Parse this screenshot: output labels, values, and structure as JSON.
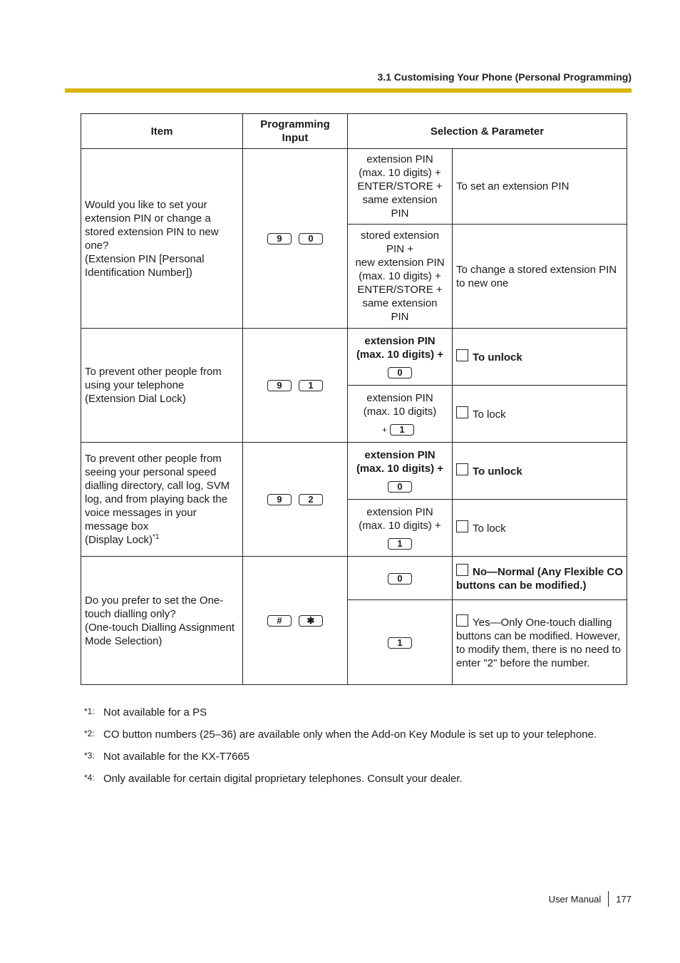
{
  "header": {
    "section_title": "3.1 Customising Your Phone (Personal Programming)",
    "rule_color": "#d9b50a"
  },
  "table": {
    "columns": [
      "Item",
      "Programming Input",
      "Selection & Parameter"
    ],
    "rows": [
      {
        "item": [
          "Would you like to set your extension PIN or change a stored extension PIN to new one?",
          "(Extension PIN [Personal Identification Number])"
        ],
        "input_keys": [
          "9",
          "0"
        ],
        "options": [
          {
            "selection": [
              "extension PIN",
              "(max. 10 digits) +",
              "ENTER/STORE +",
              "same extension",
              "PIN"
            ],
            "parameter": "To set an extension PIN"
          },
          {
            "selection": [
              "stored extension",
              "PIN +",
              "new extension PIN",
              "(max. 10 digits) +",
              "ENTER/STORE +",
              "same extension",
              "PIN"
            ],
            "parameter": "To change a stored extension PIN to new one"
          }
        ]
      },
      {
        "item": [
          "To prevent other people from using your telephone",
          "(Extension Dial Lock)"
        ],
        "input_keys": [
          "9",
          "1"
        ],
        "options": [
          {
            "selection": [
              "extension PIN",
              "(max. 10 digits) +"
            ],
            "key": "0",
            "parameter": "To unlock",
            "default": true
          },
          {
            "selection": [
              "extension PIN",
              "(max. 10 digits)"
            ],
            "key_prefix": "+",
            "key": "1",
            "parameter": "To lock"
          }
        ]
      },
      {
        "item": [
          "To prevent other people from seeing your personal speed dialling directory, call log, SVM log, and from playing back the voice messages in your message box",
          "(Display Lock)"
        ],
        "item_note": "*1",
        "input_keys": [
          "9",
          "2"
        ],
        "options": [
          {
            "selection": [
              "extension PIN",
              "(max. 10 digits) +"
            ],
            "key": "0",
            "parameter": "To unlock",
            "default": true
          },
          {
            "selection": [
              "extension PIN",
              "(max. 10 digits) +"
            ],
            "key": "1",
            "parameter": "To lock"
          }
        ]
      },
      {
        "item": [
          "Do you prefer to set the One-touch dialling only?",
          "(One-touch Dialling Assignment Mode Selection)"
        ],
        "input_keys": [
          "#",
          "✱"
        ],
        "options": [
          {
            "key": "0",
            "parameter": "No—Normal (Any Flexible CO buttons can be modified.)",
            "default": true
          },
          {
            "key": "1",
            "parameter": "Yes—Only One-touch dialling buttons can be modified. However, to modify them, there is no need to enter \"2\" before the number."
          }
        ]
      }
    ]
  },
  "footnotes": [
    {
      "mark": "*1:",
      "text": "Not available for a PS"
    },
    {
      "mark": "*2:",
      "text": "CO button numbers (25–36) are available only when the Add-on Key Module is set up to your telephone."
    },
    {
      "mark": "*3:",
      "text": "Not available for the KX-T7665"
    },
    {
      "mark": "*4:",
      "text": "Only available for certain digital proprietary telephones. Consult your dealer."
    }
  ],
  "footer": {
    "label": "User Manual",
    "page": "177"
  }
}
